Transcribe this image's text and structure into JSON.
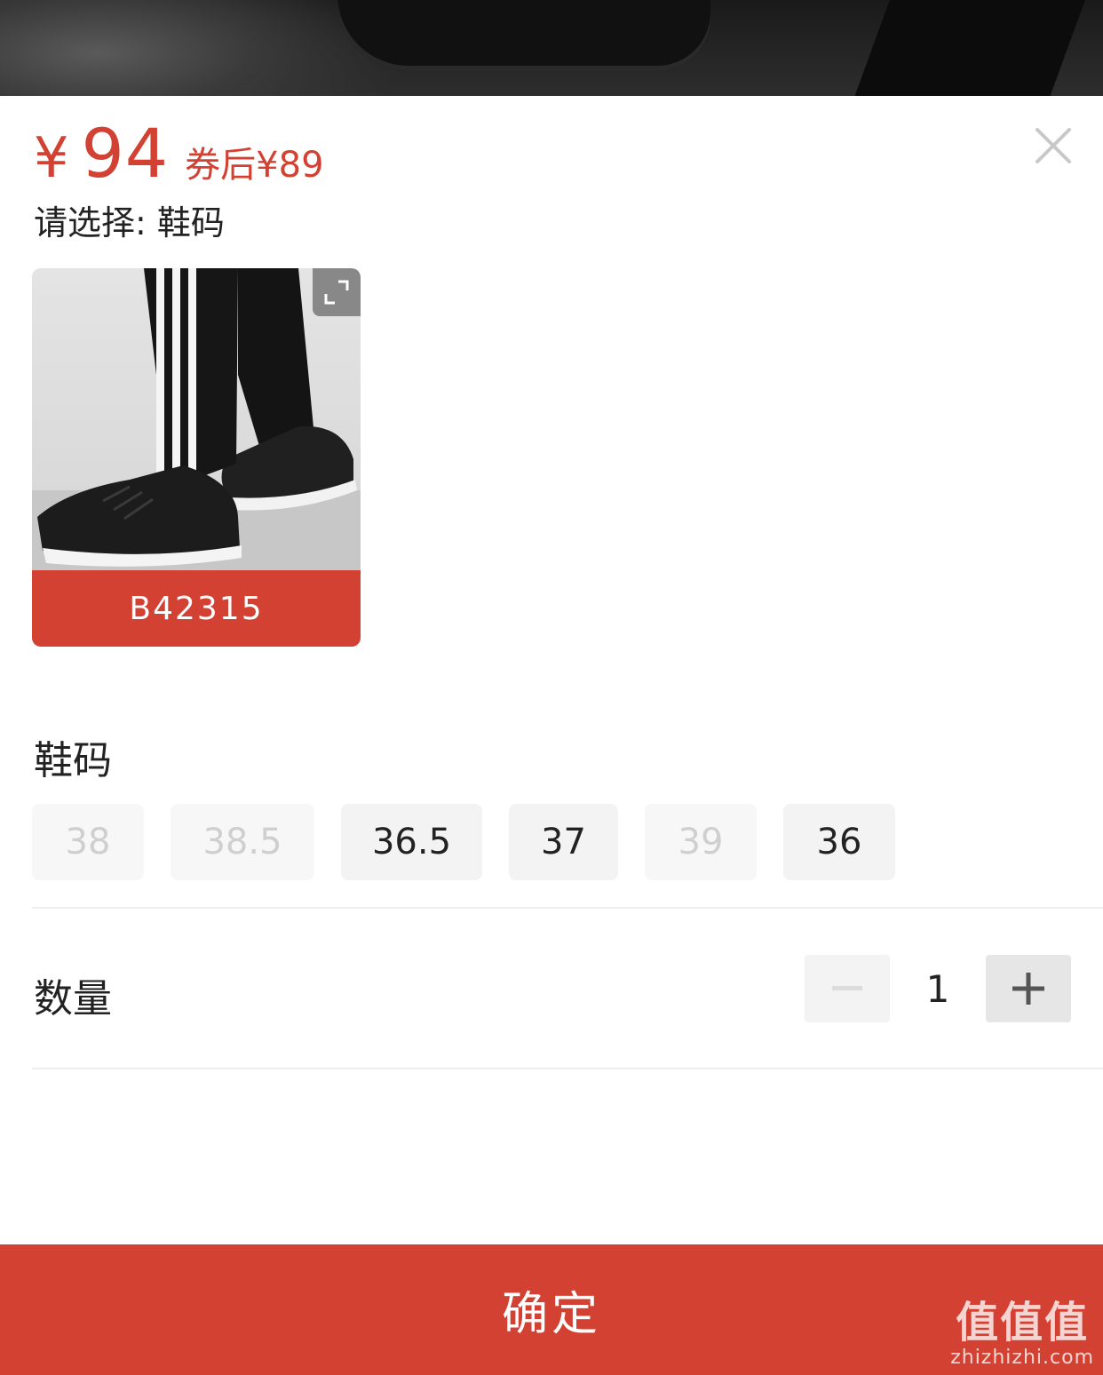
{
  "price": {
    "currency": "¥",
    "amount": "94",
    "after_coupon": "券后¥89",
    "color": "#d34132"
  },
  "prompt": "请选择: 鞋码",
  "sku": {
    "label": "B42315"
  },
  "sizes": {
    "title": "鞋码",
    "options": [
      {
        "label": "38",
        "available": false
      },
      {
        "label": "38.5",
        "available": false
      },
      {
        "label": "36.5",
        "available": true
      },
      {
        "label": "37",
        "available": true
      },
      {
        "label": "39",
        "available": false
      },
      {
        "label": "36",
        "available": true
      }
    ]
  },
  "quantity": {
    "title": "数量",
    "value": "1"
  },
  "confirm_label": "确定",
  "watermark": {
    "main": "值值值",
    "sub": "zhizhizhi.com"
  },
  "icons": {
    "close": "close-icon",
    "expand": "expand-icon",
    "minus": "minus-icon",
    "plus": "plus-icon"
  }
}
